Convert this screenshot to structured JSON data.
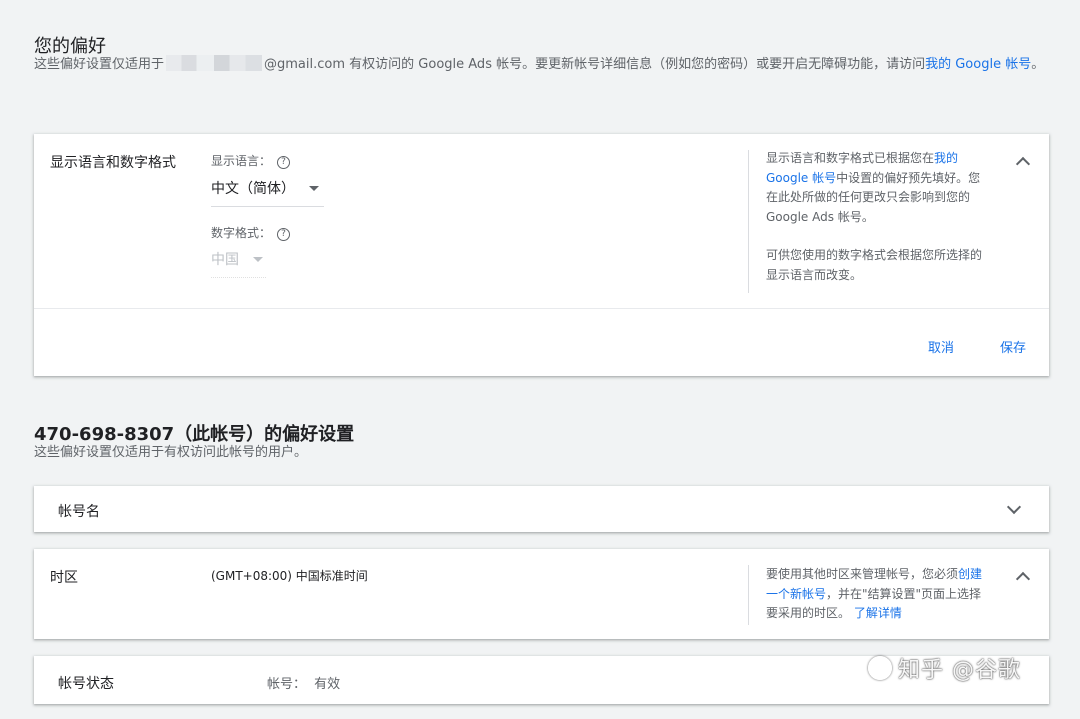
{
  "prefs": {
    "title": "您的偏好",
    "sub_before": "这些偏好设置仅适用于",
    "sub_email_suffix": "@gmail.com",
    "sub_after": " 有权访问的 Google Ads 帐号。要更新帐号详细信息（例如您的密码）或要开启无障碍功能，请访问",
    "sub_link": "我的 Google 帐号",
    "sub_end": "。"
  },
  "lang_card": {
    "label": "显示语言和数字格式",
    "display_lang_label": "显示语言：",
    "display_lang_value": "中文（简体）",
    "number_format_label": "数字格式：",
    "number_format_value": "中国",
    "help_p1_before": "显示语言和数字格式已根据您在",
    "help_p1_link": "我的 Google 帐号",
    "help_p1_after": "中设置的偏好预先填好。您在此处所做的任何更改只会影响到您的 Google Ads 帐号。",
    "help_p2": "可供您使用的数字格式会根据您所选择的显示语言而改变。",
    "cancel_label": "取消",
    "save_label": "保存"
  },
  "account": {
    "title": "470-698-8307（此帐号）的偏好设置",
    "sub": "这些偏好设置仅适用于有权访问此帐号的用户。"
  },
  "account_name_card": {
    "label": "帐号名"
  },
  "timezone_card": {
    "label": "时区",
    "value": "(GMT+08:00) 中国标准时间",
    "help_before": "要使用其他时区来管理帐号，您必须",
    "help_link": "创建一个新帐号",
    "help_after": "，并在\"结算设置\"页面上选择要采用的时区。",
    "learn_more": "了解详情"
  },
  "status_card": {
    "label": "帐号状态",
    "status_label": "帐号：",
    "status_value": "有效"
  },
  "watermark": {
    "text": "知乎 @谷歌"
  },
  "colors": {
    "link": "#1a73e8",
    "background": "#f1f3f4"
  }
}
